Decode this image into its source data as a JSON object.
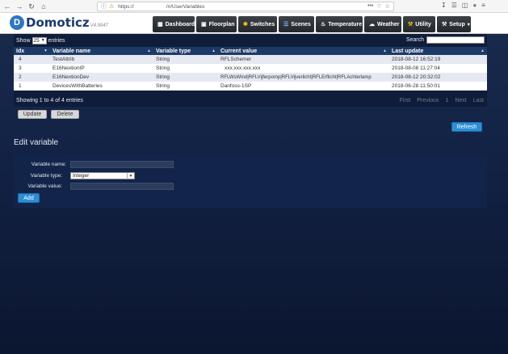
{
  "browser": {
    "url": "https://",
    "url_tail": "/#/UserVariables",
    "url_dots": "•••"
  },
  "app": {
    "logo_text": "Domoticz",
    "version": "V4.9947"
  },
  "menu": [
    {
      "label": "Dashboard",
      "icon": "▦"
    },
    {
      "label": "Floorplan",
      "icon": "▣"
    },
    {
      "label": "Switches",
      "icon": "✹"
    },
    {
      "label": "Scenes",
      "icon": "☰"
    },
    {
      "label": "Temperature",
      "icon": "♨"
    },
    {
      "label": "Weather",
      "icon": "☁"
    },
    {
      "label": "Utility",
      "icon": "⚒"
    },
    {
      "label": "Setup",
      "icon": "⚒",
      "caret": "▾"
    }
  ],
  "table": {
    "show_label": "Show",
    "entries_value": "25",
    "entries_label": "entries",
    "search_label": "Search",
    "columns": [
      "Idx",
      "Variable name",
      "Variable type",
      "Current value",
      "Last update"
    ],
    "rows": [
      {
        "idx": "4",
        "name": "TestAttrib",
        "type": "String",
        "value": "RFLSchemer",
        "updated": "2018-08-12 16:52:19"
      },
      {
        "idx": "3",
        "name": "E16NextionIP",
        "type": "String",
        "value": "xxx.xxx.xxx.xxx",
        "updated": "2018-08-08 11:27:04"
      },
      {
        "idx": "2",
        "name": "E16NextionDev",
        "type": "String",
        "value": "RFLWsWind|RFLVijferpomp|RFLVijverlicht|RFLErflicht|RFLAchterlamp",
        "updated": "2018-08-12 20:32:02"
      },
      {
        "idx": "1",
        "name": "DevicesWithBatteries",
        "type": "String",
        "value": "Danfoss-1SP",
        "updated": "2018-06-28 11:50:01"
      }
    ],
    "footer": "Showing 1 to 4 of 4 entries",
    "pager": [
      "First",
      "Previous",
      "1",
      "Next",
      "Last"
    ]
  },
  "actions": {
    "update_label": "Update",
    "delete_label": "Delete",
    "refresh_label": "Refresh"
  },
  "edit": {
    "title": "Edit variable",
    "name_label": "Variable name:",
    "type_label": "Variable type:",
    "type_value": "Integer",
    "value_label": "Variable value:",
    "add_label": "Add"
  },
  "colors": {
    "accent_blue": "#2c8ed6",
    "header_blue": "#1d3a66",
    "menu_dark": "#2b2f34"
  }
}
